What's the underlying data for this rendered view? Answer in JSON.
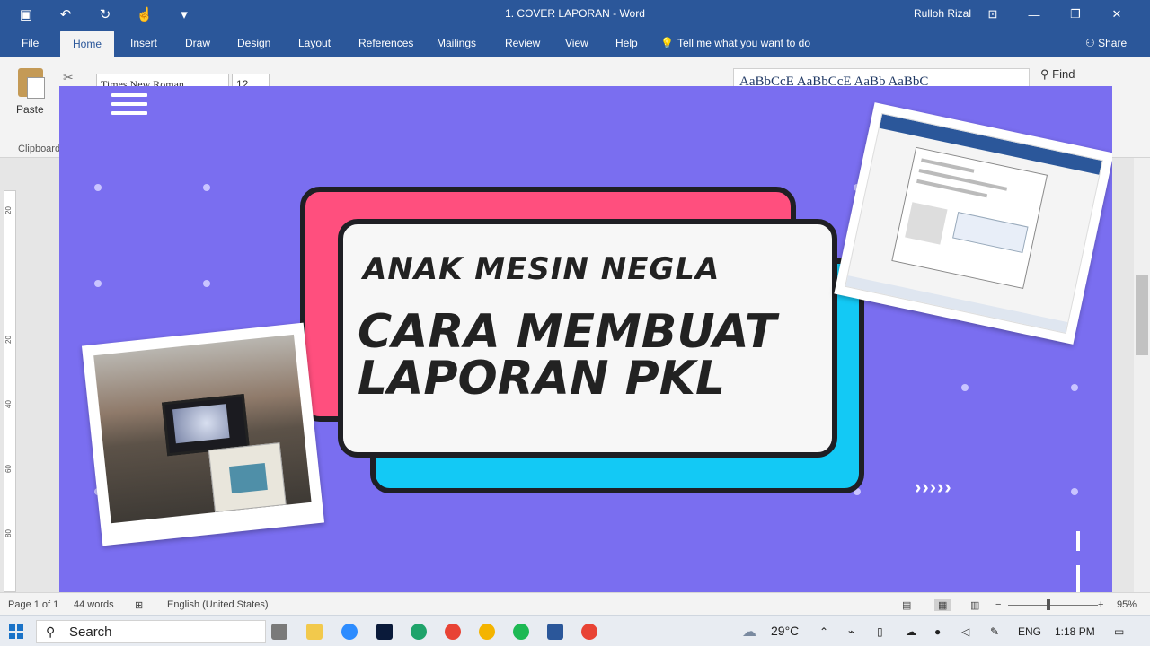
{
  "titlebar": {
    "doc_title": "1. COVER LAPORAN  -  Word",
    "user": "Rulloh Rizal",
    "qat_icons": [
      "save-icon",
      "undo-icon",
      "redo-icon",
      "touch-mode-icon",
      "customize-icon"
    ]
  },
  "tabs": [
    "File",
    "Home",
    "Insert",
    "Draw",
    "Design",
    "Layout",
    "References",
    "Mailings",
    "Review",
    "View",
    "Help"
  ],
  "tell_me": "Tell me what you want to do",
  "share": "Share",
  "ribbon": {
    "paste": "Paste",
    "clipboard_group": "Clipboard",
    "font_name": "Times New Roman",
    "font_size": "12",
    "styles_preview": "AaBbCcE  AaBbCcE  AaBb  AaBbC",
    "find": "Find"
  },
  "ruler_numbers": [
    "20",
    "20",
    "40",
    "60",
    "80"
  ],
  "thumbnail": {
    "line1": "ANAK MESIN NEGLA",
    "line2": "CARA MEMBUAT",
    "line3": "LAPORAN PKL",
    "chevrons": "›››››",
    "colors": {
      "background": "#7a6ef0",
      "pink": "#ff4f7e",
      "cyan": "#13c9f5",
      "white": "#f7f7f7"
    }
  },
  "status": {
    "page": "Page 1 of 1",
    "words": "44 words",
    "language": "English (United States)",
    "zoom": "95%"
  },
  "taskbar": {
    "search": "Search",
    "temperature": "29°C",
    "lang": "ENG",
    "time": "1:18 PM"
  }
}
